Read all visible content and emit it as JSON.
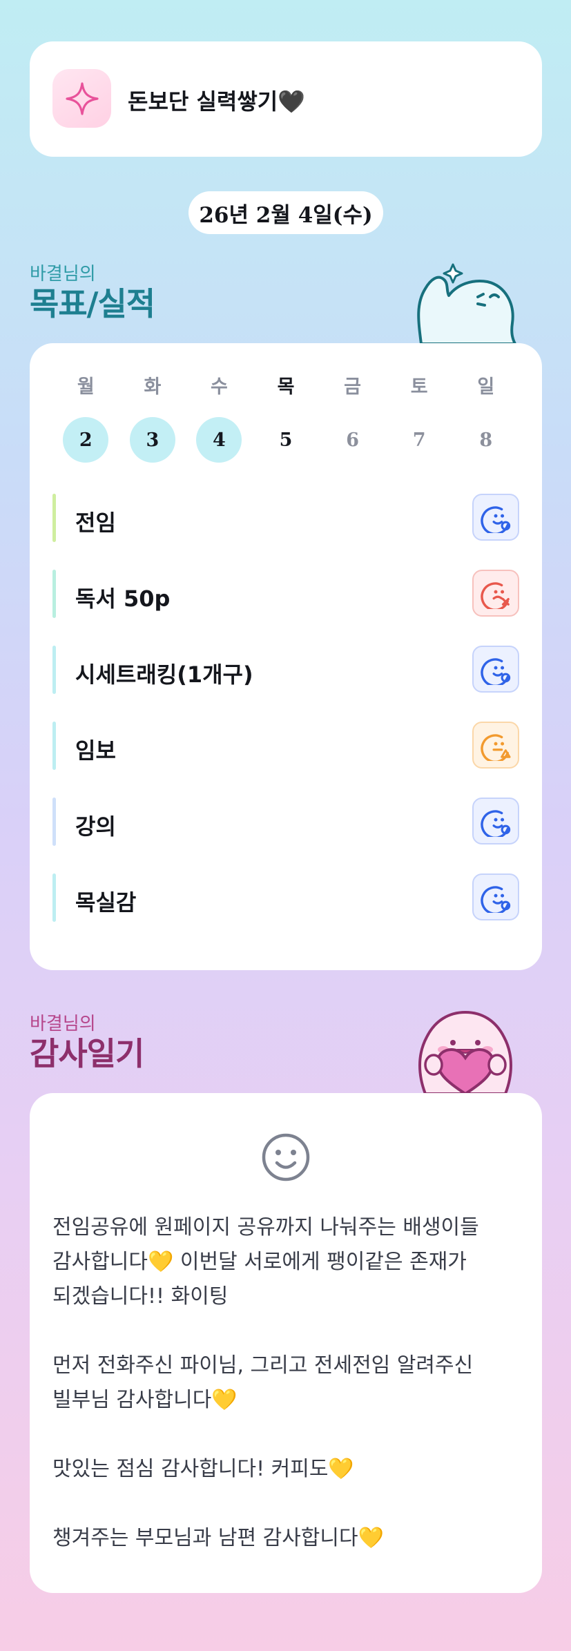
{
  "header": {
    "group_title": "돈보단 실력쌓기🖤",
    "icon": "sparkle-icon"
  },
  "date": "26년 2월 4일(수)",
  "goals_section": {
    "subtitle": "바결님의",
    "title": "목표/실적"
  },
  "week": [
    {
      "day": "월",
      "num": "2",
      "state": "done"
    },
    {
      "day": "화",
      "num": "3",
      "state": "done"
    },
    {
      "day": "수",
      "num": "4",
      "state": "done"
    },
    {
      "day": "목",
      "num": "5",
      "state": "today"
    },
    {
      "day": "금",
      "num": "6",
      "state": "future"
    },
    {
      "day": "토",
      "num": "7",
      "state": "future"
    },
    {
      "day": "일",
      "num": "8",
      "state": "future"
    }
  ],
  "goals": [
    {
      "name": "전임",
      "status": "done",
      "bar_color": "#cfee9f"
    },
    {
      "name": "독서 50p",
      "status": "fail",
      "bar_color": "#b9efe0"
    },
    {
      "name": "시세트래킹(1개구)",
      "status": "done",
      "bar_color": "#bdeef2"
    },
    {
      "name": "임보",
      "status": "partial",
      "bar_color": "#bdeef2"
    },
    {
      "name": "강의",
      "status": "done",
      "bar_color": "#cfe0fa"
    },
    {
      "name": "목실감",
      "status": "done",
      "bar_color": "#bdeef2"
    }
  ],
  "gratitude_section": {
    "subtitle": "바결님의",
    "title": "감사일기",
    "text": "전임공유에 원페이지 공유까지 나눠주는 배생이들 감사합니다💛 이번달 서로에게 팽이같은 존재가 되겠습니다!! 화이팅\n\n먼저 전화주신 파이님, 그리고 전세전임 알려주신 빌부님 감사합니다💛\n\n맛있는 점심 감사합니다! 커피도💛\n\n챙겨주는 부모님과 남편 감사합니다💛"
  },
  "colors": {
    "accent_teal": "#1e7f90",
    "accent_pink": "#8d2f6b",
    "done_blue": "#2f63e8",
    "fail_red": "#e8584c",
    "partial_orange": "#f29a2e"
  }
}
